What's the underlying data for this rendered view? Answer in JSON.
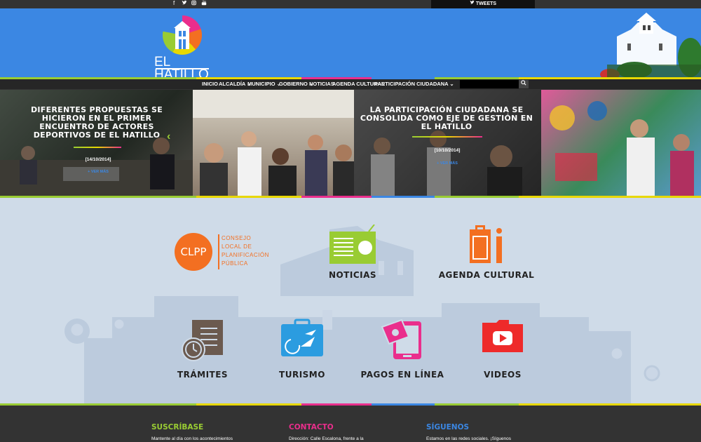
{
  "topbar": {
    "social": [
      "f",
      "🐦",
      "◎",
      "▶"
    ],
    "tweets_label": "TWEETS"
  },
  "header": {
    "logo_text": "EL HATILLO"
  },
  "nav": {
    "items": [
      "INICIO",
      "ALCALDÍA",
      "MUNICIPIO",
      "GOBIERNO",
      "NOTICIAS",
      "AGENDA CULTURAL",
      "PARTICIPACIÓN CIUDADANA"
    ],
    "search_icon": "search-icon"
  },
  "slides": [
    {
      "title": "DIFERENTES PROPUESTAS SE HICIERON EN EL PRIMER ENCUENTRO DE ACTORES DEPORTIVOS DE EL HATILLO",
      "date": "[14/10/2014]",
      "more": "+ VER MÁS"
    },
    {
      "title": "LA PARTICIPACIÓN CIUDADANA SE CONSOLIDA COMO EJE DE GESTIÓN EN EL HATILLO",
      "date": "[10/10/2014]",
      "more": "+ VER MÁS"
    }
  ],
  "clpp": {
    "badge": "CLPP",
    "lines": [
      "CONSEJO",
      "LOCAL DE",
      "PLANIFICACIÓN",
      "PÚBLICA"
    ]
  },
  "cards": {
    "noticias": "NOTICIAS",
    "agenda": "AGENDA CULTURAL",
    "tramites": "TRÁMITES",
    "turismo": "TURISMO",
    "pagos": "PAGOS EN LÍNEA",
    "videos": "VIDEOS"
  },
  "footer": {
    "suscribase": {
      "title": "SUSCRÍBASE",
      "text": "Mantente al día con los acontecimientos",
      "color": "#99cc33"
    },
    "contacto": {
      "title": "CONTACTO",
      "text": "Dirección: Calle Escalona, frente a la",
      "color": "#ea2e8c"
    },
    "siguenos": {
      "title": "SÍGUENOS",
      "text": "Estamos en las redes sociales. ¡Síguenos",
      "color": "#3b87e3"
    }
  },
  "colors": {
    "header_blue": "#3b87e3",
    "green": "#99cc33",
    "yellow": "#e8d800",
    "magenta": "#ea2e8c",
    "orange": "#f36f21",
    "red": "#ee2a2a"
  }
}
